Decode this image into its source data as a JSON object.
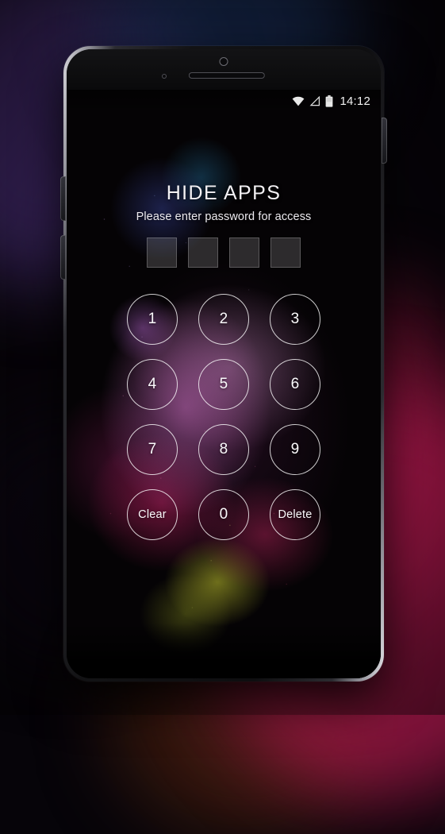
{
  "device": {
    "hardware": {
      "front_camera": "front-camera",
      "earpiece": "earpiece-speaker",
      "sensor": "proximity-sensor",
      "volume_up": "volume-up-button",
      "volume_down": "volume-down-button",
      "power": "power-button"
    }
  },
  "status_bar": {
    "wifi_icon": "wifi-icon",
    "signal_icon": "signal-icon",
    "battery_icon": "battery-icon",
    "time": "14:12"
  },
  "lock_screen": {
    "title": "HIDE APPS",
    "subtitle": "Please enter password for access",
    "pin_length": 4,
    "pin_entered": 0,
    "keypad": [
      {
        "label": "1",
        "name": "key-1",
        "type": "digit"
      },
      {
        "label": "2",
        "name": "key-2",
        "type": "digit"
      },
      {
        "label": "3",
        "name": "key-3",
        "type": "digit"
      },
      {
        "label": "4",
        "name": "key-4",
        "type": "digit"
      },
      {
        "label": "5",
        "name": "key-5",
        "type": "digit"
      },
      {
        "label": "6",
        "name": "key-6",
        "type": "digit"
      },
      {
        "label": "7",
        "name": "key-7",
        "type": "digit"
      },
      {
        "label": "8",
        "name": "key-8",
        "type": "digit"
      },
      {
        "label": "9",
        "name": "key-9",
        "type": "digit"
      },
      {
        "label": "Clear",
        "name": "key-clear",
        "type": "word"
      },
      {
        "label": "0",
        "name": "key-0",
        "type": "digit"
      },
      {
        "label": "Delete",
        "name": "key-delete",
        "type": "word"
      }
    ]
  },
  "colors": {
    "text": "#fbfafc",
    "key_border": "rgba(255,255,255,0.80)",
    "pin_fill": "rgba(255,255,255,0.16)",
    "backdrop": "#070409",
    "glow_magenta": "#b0184e",
    "glow_violet": "#56368c"
  }
}
